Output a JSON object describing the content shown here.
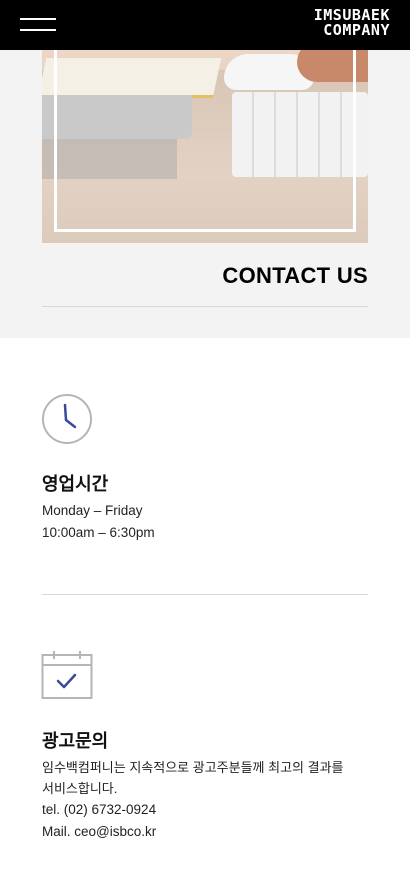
{
  "header": {
    "logo_line1": "IMSUBAEK",
    "logo_line2": "COMPANY",
    "menu_icon": "hamburger-menu-icon"
  },
  "hero": {
    "title": "CONTACT US"
  },
  "hours": {
    "icon": "clock-icon",
    "title": "영업시간",
    "days": "Monday – Friday",
    "time": "10:00am – 6:30pm"
  },
  "inquiry": {
    "icon": "calendar-check-icon",
    "title": "광고문의",
    "desc_line1": "임수백컴퍼니는 지속적으로 광고주분들께 최고의 결과를",
    "desc_line2": "서비스합니다.",
    "tel": "tel. (02) 6732-0924",
    "mail": "Mail. ceo@isbco.kr"
  },
  "colors": {
    "accent": "#3a4a9a",
    "header_bg": "#000000",
    "hero_bg": "#f3f3f3",
    "divider": "#d8d8d8",
    "icon_stroke": "#b5b5b5"
  }
}
